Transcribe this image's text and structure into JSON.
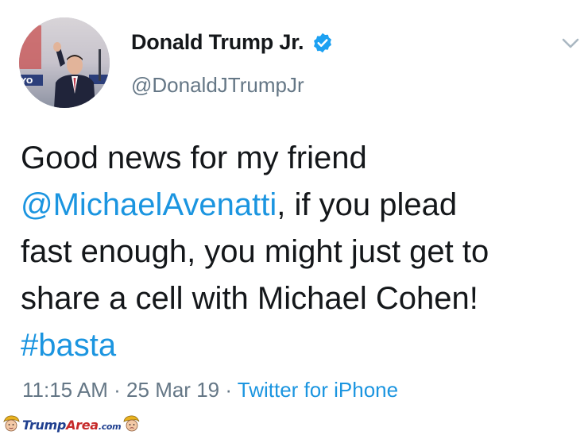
{
  "author": {
    "display_name": "Donald Trump Jr.",
    "handle": "@DonaldJTrumpJr",
    "verified": true
  },
  "tweet": {
    "lines": [
      {
        "parts": [
          {
            "type": "text",
            "value": "Good news for my friend"
          }
        ]
      },
      {
        "parts": [
          {
            "type": "mention",
            "value": "@MichaelAvenatti"
          },
          {
            "type": "text",
            "value": ", if you plead"
          }
        ]
      },
      {
        "parts": [
          {
            "type": "text",
            "value": "fast enough, you might just get to"
          }
        ]
      },
      {
        "parts": [
          {
            "type": "text",
            "value": "share a cell with Michael Cohen!"
          }
        ]
      },
      {
        "parts": [
          {
            "type": "hashtag",
            "value": "#basta"
          }
        ]
      }
    ]
  },
  "meta": {
    "time": "11:15 AM",
    "separator": " · ",
    "date": "25 Mar 19",
    "source": "Twitter for iPhone"
  },
  "watermark": {
    "brand_main": "Trump",
    "brand_area": "Area",
    "brand_tld": ".com"
  },
  "icons": {
    "verified": "verified-badge-icon",
    "menu": "chevron-down-icon"
  },
  "colors": {
    "link": "#1b95e0",
    "text": "#14171a",
    "secondary": "#657786",
    "verified": "#1da1f2"
  }
}
